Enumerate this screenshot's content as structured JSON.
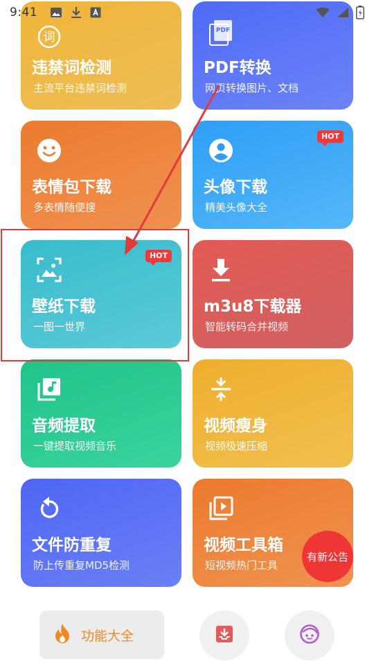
{
  "status": {
    "time": "9:41",
    "left_icons": [
      "image-icon",
      "download-icon",
      "font-icon"
    ],
    "right_icons": [
      "wifi-icon",
      "signal-icon",
      "battery-icon"
    ]
  },
  "cards": [
    {
      "title": "违禁词检测",
      "subtitle": "主流平台违禁词检测",
      "icon": "ci-icon",
      "color": "#f1b53a",
      "hot": ""
    },
    {
      "title": "PDF转换",
      "subtitle": "网页转换图片、文档",
      "icon": "pdf-icon",
      "color": "#4f6af6",
      "hot": ""
    },
    {
      "title": "表情包下载",
      "subtitle": "多表情随便搜",
      "icon": "smiley-icon",
      "color": "#ec7b2f",
      "hot": ""
    },
    {
      "title": "头像下载",
      "subtitle": "精美头像大全",
      "icon": "person-icon",
      "color": "#2e9ef6",
      "hot": "HOT"
    },
    {
      "title": "壁纸下载",
      "subtitle": "一图一世界",
      "icon": "wallpaper-icon",
      "color": "#37bccc",
      "hot": "HOT"
    },
    {
      "title": "m3u8下载器",
      "subtitle": "智能转码合并视频",
      "icon": "download-icon",
      "color": "#e45a54",
      "hot": ""
    },
    {
      "title": "音频提取",
      "subtitle": "一键提取视频音乐",
      "icon": "music-library-icon",
      "color": "#1fc489",
      "hot": ""
    },
    {
      "title": "视频瘦身",
      "subtitle": "视频极速压缩",
      "icon": "compress-icon",
      "color": "#efaf2f",
      "hot": ""
    },
    {
      "title": "文件防重复",
      "subtitle": "防上传重复MD5检测",
      "icon": "replay-icon",
      "color": "#4f66f4",
      "hot": ""
    },
    {
      "title": "视频工具箱",
      "subtitle": "短视频热门工具",
      "icon": "video-library-icon",
      "color": "#ec7a2e",
      "hot": ""
    }
  ],
  "notice": {
    "label": "有新公告",
    "color": "#f03535"
  },
  "bottom_nav": {
    "main_label": "功能大全",
    "main_icon": "flame-icon",
    "main_color": "#f08a24",
    "second_icon": "inbox-download-icon",
    "third_icon": "face-icon"
  }
}
